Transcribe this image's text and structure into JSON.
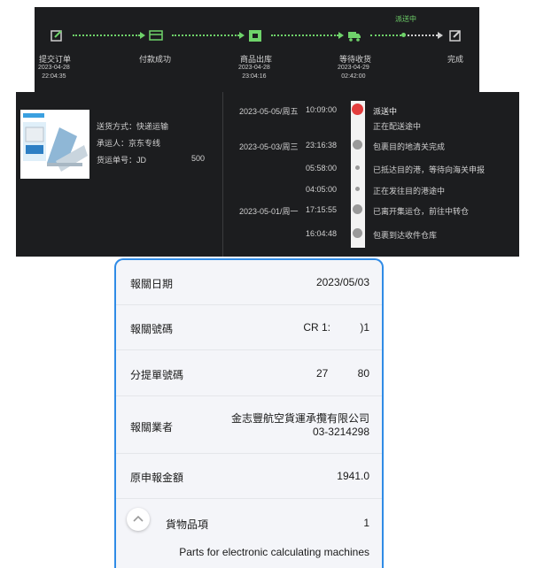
{
  "progress": {
    "current_tag": "派送中",
    "steps": [
      {
        "label": "提交订单",
        "date": "2023-04-28",
        "time": "22:04:35"
      },
      {
        "label": "付款成功",
        "date": "",
        "time": ""
      },
      {
        "label": "商品出库",
        "date": "2023-04-28",
        "time": "23:04:16"
      },
      {
        "label": "等待收货",
        "date": "2023-04-29",
        "time": "02:42:00"
      },
      {
        "label": "完成",
        "date": "",
        "time": ""
      }
    ],
    "accent_color": "#6fd36a"
  },
  "shipment": {
    "delivery_method": "送货方式：快递运输",
    "carrier": "承运人：京东专线",
    "tracking_label": "货运单号：JD",
    "tracking_tail": "500",
    "timeline": [
      {
        "date": "2023-05-05/周五",
        "time": "10:09:00",
        "status": "派送中",
        "detail": "正在配送途中"
      },
      {
        "date": "2023-05-03/周三",
        "time": "23:16:38",
        "status": "包裹目的地清关完成"
      },
      {
        "date": "",
        "time": "05:58:00",
        "status": "已抵达目的港，等待向海关申报"
      },
      {
        "date": "",
        "time": "04:05:00",
        "status": "正在发往目的港途中"
      },
      {
        "date": "2023-05-01/周一",
        "time": "17:15:55",
        "status": "已离开集运仓，前往中转仓"
      },
      {
        "date": "",
        "time": "16:04:48",
        "status": "包裹到达收件仓库"
      }
    ]
  },
  "customs": {
    "rows": [
      {
        "label": "報關日期",
        "value": "2023/05/03"
      },
      {
        "label": "報關號碼",
        "value": "CR 1:          )1"
      },
      {
        "label": "分提單號碼",
        "value": "27          80"
      },
      {
        "label": "報關業者",
        "value": "金志豐航空貨運承攬有限公司",
        "value2": "03-3214298"
      },
      {
        "label": "原申報金額",
        "value": "1941.0"
      },
      {
        "label": "貨物品項",
        "value": "1"
      }
    ],
    "item_description": "Parts for electronic calculating machines",
    "border_color": "#2f8be6"
  }
}
